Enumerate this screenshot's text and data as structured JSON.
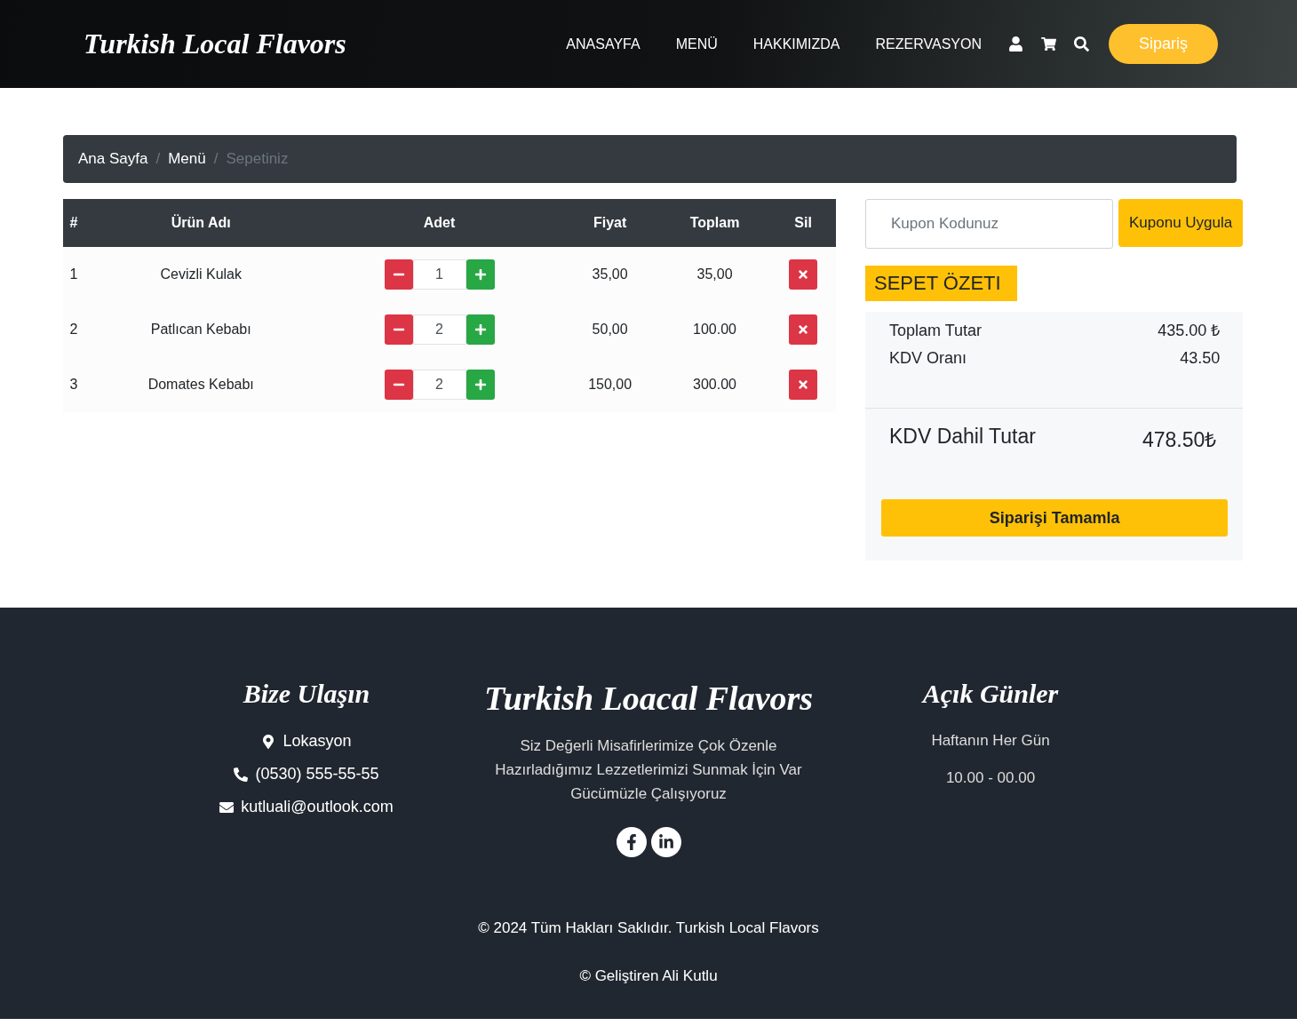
{
  "header": {
    "logo": "Turkish Local Flavors",
    "nav": [
      {
        "label": "ANASAYFA"
      },
      {
        "label": "MENÜ"
      },
      {
        "label": "HAKKIMIZDA"
      },
      {
        "label": "REZERVASYON"
      }
    ],
    "order_button": "Sipariş"
  },
  "breadcrumb": [
    {
      "label": "Ana Sayfa",
      "selected": false
    },
    {
      "separator": "/"
    },
    {
      "label": "Menü",
      "selected": false
    },
    {
      "separator": "/"
    },
    {
      "label": "Sepetiniz",
      "selected": true
    }
  ],
  "cart": {
    "columns": [
      "#",
      "Ürün Adı",
      "Adet",
      "Fiyat",
      "Toplam",
      "Sil"
    ],
    "rows": [
      {
        "index": "1",
        "name": "Cevizli Kulak",
        "quantity": "1",
        "price": "35,00",
        "total": "35,00"
      },
      {
        "index": "2",
        "name": "Patlıcan Kebabı",
        "quantity": "2",
        "price": "50,00",
        "total": "100.00"
      },
      {
        "index": "3",
        "name": "Domates Kebabı",
        "quantity": "2",
        "price": "150,00",
        "total": "300.00"
      }
    ]
  },
  "coupon": {
    "placeholder": "Kupon Kodunuz",
    "button": "Kuponu Uygula"
  },
  "summary": {
    "title": "SEPET ÖZETI",
    "lines": [
      {
        "label": "Toplam Tutar",
        "value": "435.00 ₺"
      },
      {
        "label": "KDV Oranı",
        "value": "43.50"
      }
    ],
    "grand_label": "KDV Dahil Tutar",
    "grand_value": "478.50₺",
    "button": "Siparişi Tamamla"
  },
  "footer": {
    "contact": {
      "title": "Bize Ulaşın",
      "items": [
        {
          "kind": "location",
          "text": "Lokasyon"
        },
        {
          "kind": "phone",
          "text": "(0530) 555-55-55"
        },
        {
          "kind": "email",
          "text": "kutluali@outlook.com"
        }
      ]
    },
    "about": {
      "title": "Turkish Loacal Flavors",
      "text": "Siz Değerli Misafirlerimize Çok Özenle Hazırladığımız Lezzetlerimizi Sunmak İçin Var Gücümüzle Çalışıyoruz",
      "social": [
        {
          "kind": "facebook"
        },
        {
          "kind": "linkedin"
        }
      ]
    },
    "hours": {
      "title": "Açık Günler",
      "days": "Haftanın Her Gün",
      "time": "10.00 - 00.00"
    },
    "copyright": "© 2024 Tüm Hakları Saklıdır. Turkish Local Flavors",
    "developer": "© Geliştiren Ali Kutlu"
  }
}
